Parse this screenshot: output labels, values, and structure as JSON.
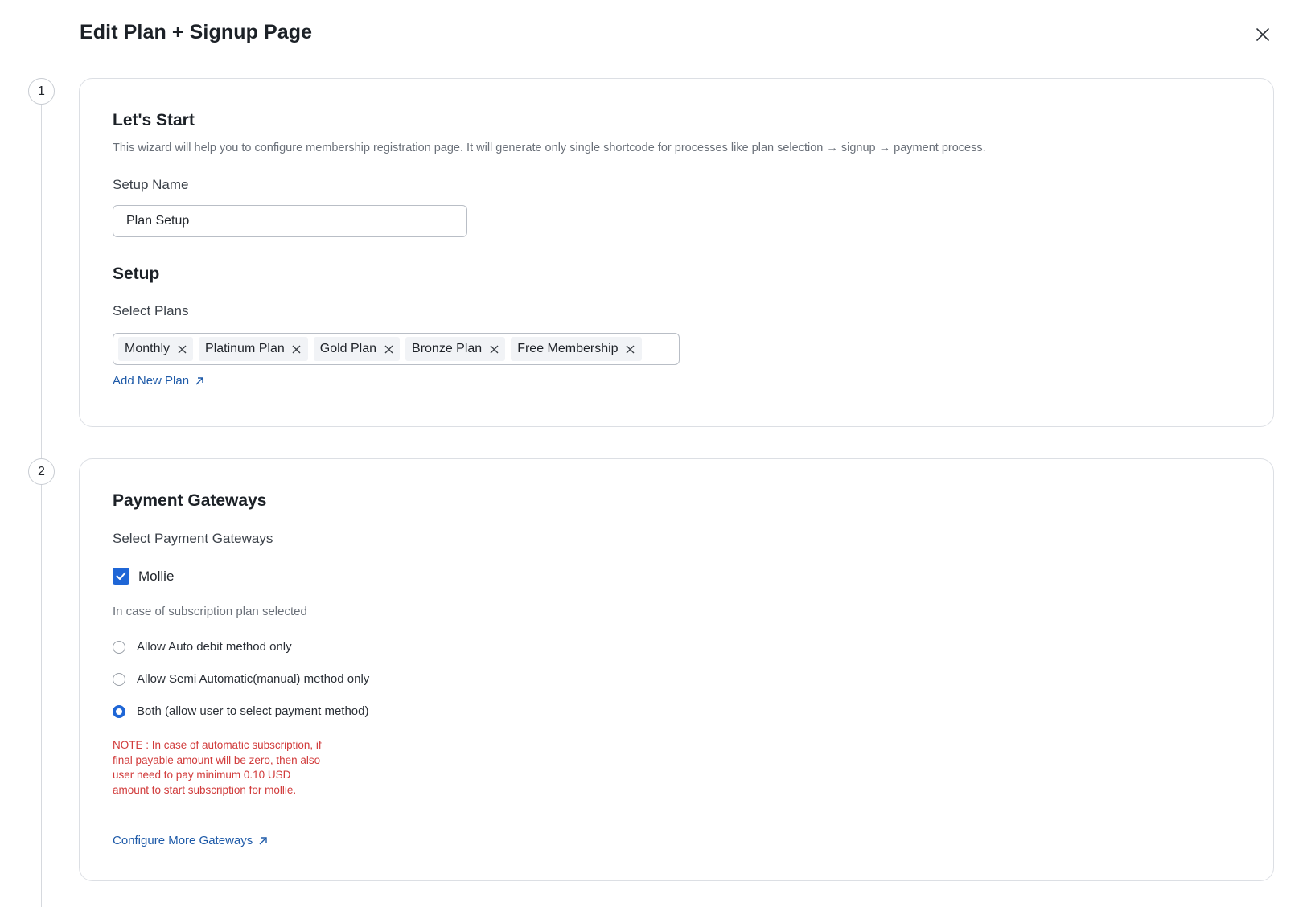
{
  "page": {
    "title": "Edit Plan + Signup Page"
  },
  "steps": [
    "1",
    "2"
  ],
  "lets_start": {
    "heading": "Let's Start",
    "description": "This wizard will help you to configure membership registration page. It will generate only single shortcode for processes like plan selection → signup → payment process.",
    "setup_name_label": "Setup Name",
    "setup_name_value": "Plan Setup"
  },
  "setup": {
    "heading": "Setup",
    "select_plans_label": "Select Plans",
    "plans": [
      "Monthly",
      "Platinum Plan",
      "Gold Plan",
      "Bronze Plan",
      "Free Membership"
    ],
    "add_new_plan_link": "Add New Plan"
  },
  "payment": {
    "heading": "Payment Gateways",
    "select_label": "Select Payment Gateways",
    "gateway_label": "Mollie",
    "gateway_checked": true,
    "subscription_label": "In case of subscription plan selected",
    "options": [
      {
        "label": "Allow Auto debit method only",
        "checked": false
      },
      {
        "label": "Allow Semi Automatic(manual) method only",
        "checked": false
      },
      {
        "label": "Both (allow user to select payment method)",
        "checked": true
      }
    ],
    "note": "NOTE : In case of automatic subscription, if final payable amount will be zero, then also user need to pay minimum 0.10 USD amount to start subscription for mollie.",
    "configure_link": "Configure More Gateways"
  },
  "colors": {
    "accent": "#1f66d6",
    "link": "#1e5aa8",
    "note": "#d13b3b"
  },
  "icons": {
    "close": "close-icon",
    "tag_remove": "tag-remove-icon",
    "external": "external-link-icon",
    "check": "check-icon"
  }
}
